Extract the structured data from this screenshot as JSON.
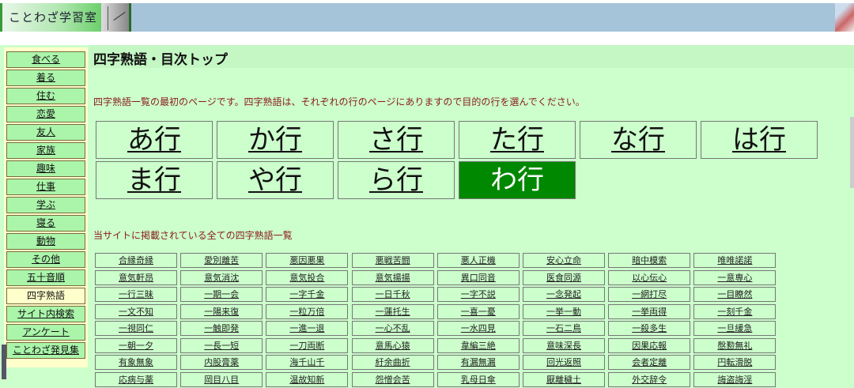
{
  "header": {
    "logo_text": "ことわざ学習室"
  },
  "sidebar": {
    "items": [
      {
        "label": "食べる"
      },
      {
        "label": "着る"
      },
      {
        "label": "住む"
      },
      {
        "label": "恋愛"
      },
      {
        "label": "友人"
      },
      {
        "label": "家族"
      },
      {
        "label": "趣味"
      },
      {
        "label": "仕事"
      },
      {
        "label": "学ぶ"
      },
      {
        "label": "寝る"
      },
      {
        "label": "動物"
      },
      {
        "label": "その他"
      },
      {
        "label": "五十音順"
      },
      {
        "label": "四字熟語",
        "current": true
      },
      {
        "label": "サイト内検索"
      },
      {
        "label": "アンケート"
      },
      {
        "label": "ことわざ発見集"
      }
    ]
  },
  "main": {
    "title": "四字熟語・目次トップ",
    "intro": "四字熟語一覧の最初のページです。四字熟語は、それぞれの行のページにありますので目的の行を選んでください。",
    "kana_rows": [
      {
        "label": "あ行"
      },
      {
        "label": "か行"
      },
      {
        "label": "さ行"
      },
      {
        "label": "た行"
      },
      {
        "label": "な行"
      },
      {
        "label": "は行"
      },
      {
        "label": "ま行"
      },
      {
        "label": "や行"
      },
      {
        "label": "ら行"
      },
      {
        "label": "わ行",
        "selected": true
      }
    ],
    "list_heading": "当サイトに掲載されている全ての四字熟語一覧",
    "words": [
      [
        "合縁奇縁",
        "愛別離苦",
        "悪因悪果",
        "悪戦苦闘",
        "悪人正機",
        "安心立命",
        "暗中模索",
        "唯唯諾諾"
      ],
      [
        "意気軒昂",
        "意気消沈",
        "意気投合",
        "意気揚揚",
        "異口同音",
        "医食同源",
        "以心伝心",
        "一意専心"
      ],
      [
        "一行三昧",
        "一期一会",
        "一字千金",
        "一日千秋",
        "一字不説",
        "一念発起",
        "一網打尽",
        "一目瞭然"
      ],
      [
        "一文不知",
        "一陽来復",
        "一粒万倍",
        "一蓮托生",
        "一喜一憂",
        "一挙一動",
        "一挙両得",
        "一刻千金"
      ],
      [
        "一視同仁",
        "一触即発",
        "一進一退",
        "一心不乱",
        "一水四見",
        "一石二鳥",
        "一殺多生",
        "一旦緩急"
      ],
      [
        "一朝一夕",
        "一長一短",
        "一刀両断",
        "意馬心猿",
        "韋編三絶",
        "意味深長",
        "因果応報",
        "慇懃無礼"
      ],
      [
        "有象無象",
        "内股膏薬",
        "海千山千",
        "紆余曲折",
        "有漏無漏",
        "回光返照",
        "会者定離",
        "円転滑脱"
      ],
      [
        "応病与薬",
        "岡目八目",
        "温故知新",
        "怨憎会苦",
        "乳母日傘",
        "厭離穢土",
        "外交辞令",
        "誨盗誨淫"
      ]
    ]
  }
}
